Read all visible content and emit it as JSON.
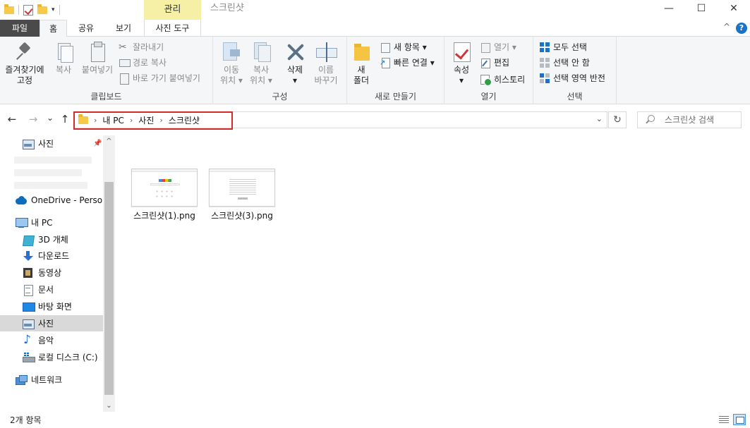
{
  "window": {
    "title": "스크린샷",
    "context_tab_header": "관리",
    "controls": {
      "minimize": "—",
      "maximize": "☐",
      "close": "✕"
    }
  },
  "quick_access": {
    "dropdown": "▾"
  },
  "ribbon_tabs": {
    "file": "파일",
    "home": "홈",
    "share": "공유",
    "view": "보기",
    "picture_tools": "사진 도구",
    "collapse": "^",
    "help": "?"
  },
  "clipboard": {
    "pin": "즐겨찾기에\n고정",
    "copy": "복사",
    "paste": "붙여넣기",
    "cut": "잘라내기",
    "copy_path": "경로 복사",
    "paste_shortcut": "바로 가기 붙여넣기",
    "label": "클립보드"
  },
  "organize": {
    "move_to": "이동\n위치 ▾",
    "copy_to": "복사\n위치 ▾",
    "delete": "삭제\n▾",
    "rename": "이름\n바꾸기",
    "label": "구성"
  },
  "new": {
    "new_folder": "새\n폴더",
    "new_item": "새 항목 ▾",
    "easy_access": "빠른 연결 ▾",
    "label": "새로 만들기"
  },
  "open": {
    "properties": "속성\n▾",
    "open": "열기 ▾",
    "edit": "편집",
    "history": "히스토리",
    "label": "열기"
  },
  "select": {
    "select_all": "모두 선택",
    "select_none": "선택 안 함",
    "invert": "선택 영역 반전",
    "label": "선택"
  },
  "nav": {
    "back": "←",
    "forward": "→",
    "recent": "⌄",
    "up": "↑",
    "breadcrumb": [
      "내 PC",
      "사진",
      "스크린샷"
    ],
    "breadcrumb_sep": "›",
    "address_dropdown": "⌄",
    "refresh": "↻",
    "search_placeholder": "스크린샷 검색"
  },
  "navpane": {
    "quick_photos": "사진",
    "onedrive": "OneDrive - Persona",
    "this_pc": "내 PC",
    "items": [
      "3D 개체",
      "다운로드",
      "동영상",
      "문서",
      "바탕 화면",
      "사진",
      "음악",
      "로컬 디스크 (C:)"
    ],
    "network": "네트워크",
    "pin_glyph": "📌",
    "scroll_up": "^",
    "scroll_down": "⌄"
  },
  "files": [
    {
      "name": "스크린샷(1).png",
      "thumb": "google-page"
    },
    {
      "name": "스크린샷(3).png",
      "thumb": "document-page"
    }
  ],
  "status": {
    "item_count": "2개 항목"
  },
  "colors": {
    "context_header": "#f6f0a6",
    "file_tab": "#4a4a4a",
    "highlight_border": "#d32a2a",
    "selected_nav": "#d9d9d9"
  }
}
